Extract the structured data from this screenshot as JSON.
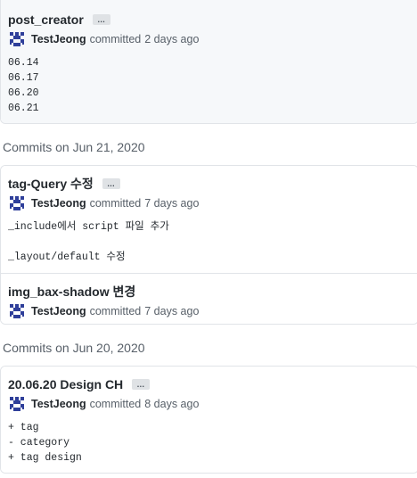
{
  "groups": [
    {
      "heading": "",
      "commits": [
        {
          "title": "post_creator",
          "author": "TestJeong",
          "action": "committed",
          "time": "2 days ago",
          "description": "06.14\n06.17\n06.20\n06.21",
          "ellipsis": "…"
        }
      ]
    },
    {
      "heading": "Commits on Jun 21, 2020",
      "commits": [
        {
          "title": "tag-Query 수정",
          "author": "TestJeong",
          "action": "committed",
          "time": "7 days ago",
          "description": "_include에서 script 파일 추가\n\n_layout/default 수정",
          "ellipsis": "…"
        },
        {
          "title": "img_bax-shadow 변경",
          "author": "TestJeong",
          "action": "committed",
          "time": "7 days ago"
        }
      ]
    },
    {
      "heading": "Commits on Jun 20, 2020",
      "commits": [
        {
          "title": "20.06.20 Design CH",
          "author": "TestJeong",
          "action": "committed",
          "time": "8 days ago",
          "description": "+ tag\n- category\n+ tag design",
          "ellipsis": "…"
        }
      ]
    }
  ],
  "colors": {
    "avatar_fill": "#2f3f9a",
    "selected_bg": "#f6f8fa",
    "border": "#e1e4e8",
    "muted_text": "#586069"
  },
  "icons": {
    "avatar": "identicon-avatar",
    "ellipsis": "expand-description-button"
  }
}
